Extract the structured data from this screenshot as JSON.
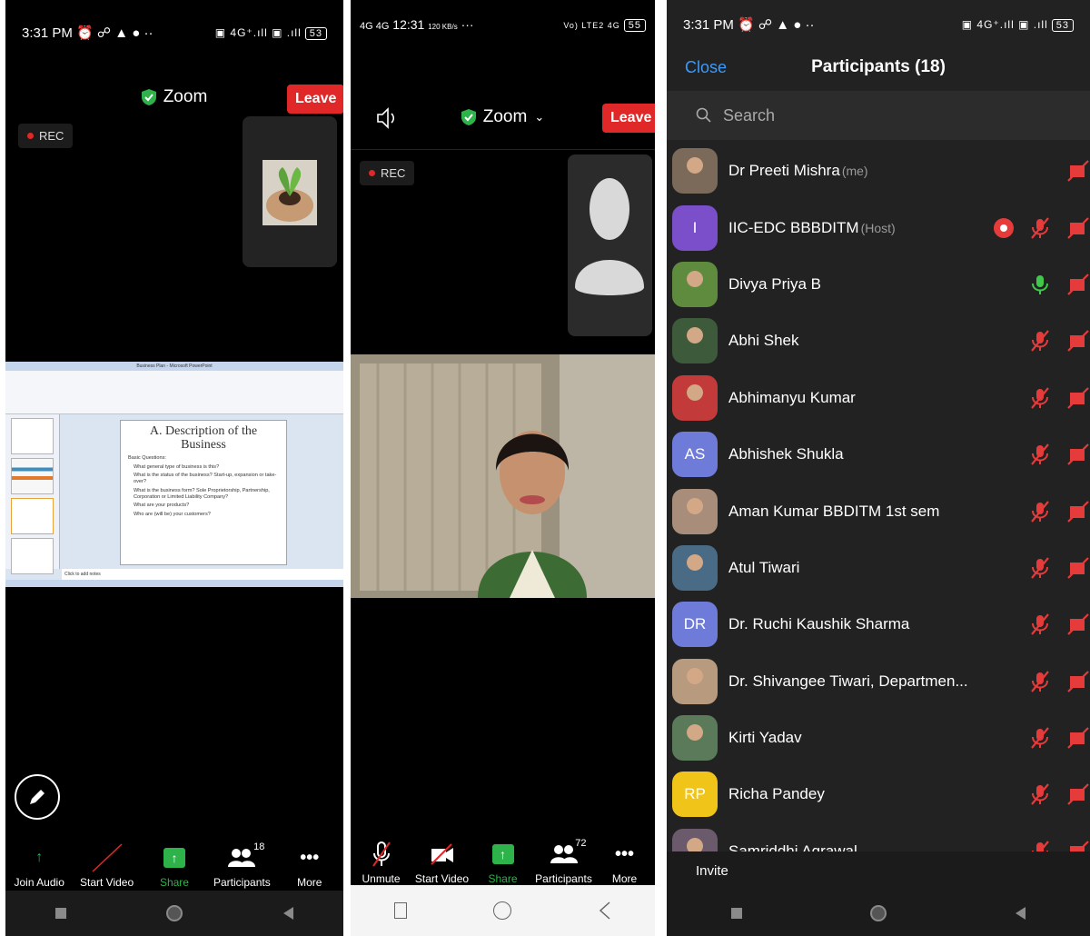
{
  "panel1": {
    "time": "3:31 PM",
    "status_icons": "⏰ ☍ ▲ ●  ··",
    "net": "▣ 4G⁺.ıll ▣ .ıll",
    "battery": "53",
    "app_title": "Zoom",
    "leave_label": "Leave",
    "rec_label": "REC",
    "slide": {
      "window_title": "Business Plan - Microsoft PowerPoint",
      "heading": "A. Description of the Business",
      "bullets": [
        "Basic Questions:",
        "What general type of business is this?",
        "What is the status of the business? Start-up, expansion or take-over?",
        "What is the business form? Sole Proprietorship, Partnership, Corporation or Limited Liability Company?",
        "What are your products?",
        "Who are (will be) your customers?"
      ],
      "notes": "Click to add notes"
    },
    "toolbar": [
      {
        "label": "Join Audio"
      },
      {
        "label": "Start Video"
      },
      {
        "label": "Share"
      },
      {
        "label": "Participants",
        "count": "18"
      },
      {
        "label": "More"
      }
    ]
  },
  "panel2": {
    "time": "12:31",
    "signal": "4G 4G",
    "speed": "120 KB/s",
    "right_status": "Vo) LTE2 4G",
    "battery": "55",
    "app_title": "Zoom",
    "leave_label": "Leave",
    "rec_label": "REC",
    "toolbar": [
      {
        "label": "Unmute"
      },
      {
        "label": "Start Video"
      },
      {
        "label": "Share"
      },
      {
        "label": "Participants",
        "count": "72"
      },
      {
        "label": "More"
      }
    ]
  },
  "panel3": {
    "time": "3:31 PM",
    "status_icons": "⏰ ☍ ▲ ●  ··",
    "net": "▣ 4G⁺.ıll ▣ .ıll",
    "battery": "53",
    "close_label": "Close",
    "title": "Participants (18)",
    "search_placeholder": "Search",
    "participants": [
      {
        "name": "Dr Preeti Mishra",
        "tag": "(me)",
        "avatar": "photo",
        "color": "#7b6a5a"
      },
      {
        "name": "IIC-EDC BBBDITM",
        "tag": "(Host)",
        "avatar": "I",
        "color": "#7a4fc9",
        "recording": true
      },
      {
        "name": "Divya Priya B",
        "avatar": "photo",
        "color": "#5f8b3f",
        "mic_on": true
      },
      {
        "name": "Abhi Shek",
        "avatar": "photo",
        "color": "#3d5a3a"
      },
      {
        "name": "Abhimanyu Kumar",
        "avatar": "photo",
        "color": "#c23a3a"
      },
      {
        "name": "Abhishek Shukla",
        "avatar": "AS",
        "color": "#6f7bd9"
      },
      {
        "name": "Aman Kumar BBDITM 1st sem",
        "avatar": "photo",
        "color": "#a88d7a"
      },
      {
        "name": "Atul Tiwari",
        "avatar": "photo",
        "color": "#4a6b86"
      },
      {
        "name": "Dr. Ruchi Kaushik Sharma",
        "avatar": "DR",
        "color": "#6f7bd9"
      },
      {
        "name": "Dr. Shivangee Tiwari, Departmen...",
        "avatar": "photo",
        "color": "#b89a7e"
      },
      {
        "name": "Kirti Yadav",
        "avatar": "photo",
        "color": "#5a7a5a"
      },
      {
        "name": "Richa Pandey",
        "avatar": "RP",
        "color": "#f0c419"
      },
      {
        "name": "Samriddhi Agrawal",
        "avatar": "photo",
        "color": "#6b5a6b"
      }
    ],
    "invite_label": "Invite"
  },
  "colors": {
    "leave_red": "#e02828",
    "share_green": "#2db34a",
    "link_blue": "#3a9bff",
    "mute_red": "#e63b3b"
  }
}
